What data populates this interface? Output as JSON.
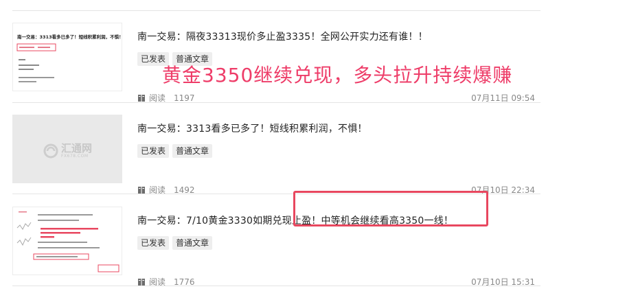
{
  "articles": [
    {
      "title": "南一交易：隔夜33313现价多止盈3335！全网公开实力还有谁！！",
      "tags": [
        "已发表",
        "普通文章"
      ],
      "read_label": "阅读",
      "read_count": "1197",
      "date": "07月11日 09:54",
      "thumbnail_text": "南一交易：3313看多已多了！短线积累利润，不惧！"
    },
    {
      "title": "南一交易：3313看多已多了！短线积累利润，不惧！",
      "tags": [
        "已发表",
        "普通文章"
      ],
      "read_label": "阅读",
      "read_count": "1492",
      "date": "07月10日 22:34",
      "thumbnail_logo": {
        "name": "汇通网",
        "url": "FX678.COM"
      }
    },
    {
      "title": "南一交易：7/10黄金3330如期兑现止盈！中等机会继续看高3350一线！",
      "tags": [
        "已发表",
        "普通文章"
      ],
      "read_label": "阅读",
      "read_count": "1776",
      "date": "07月10日 15:31"
    }
  ],
  "overlay": {
    "text": "黄金3350继续兑现，多头拉升持续爆赚",
    "color": "#ee3c68"
  },
  "highlight_color": "#e8475f",
  "icons": {
    "read": "book-icon",
    "logo": "fx678-logo-icon"
  }
}
